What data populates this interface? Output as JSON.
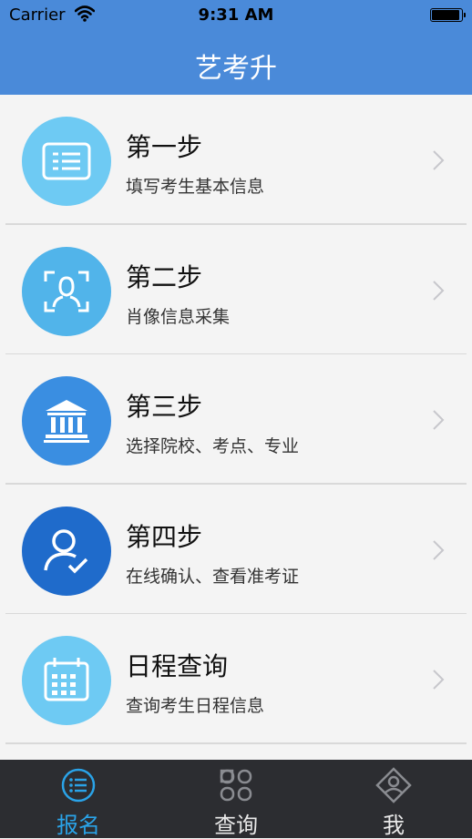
{
  "status_bar": {
    "carrier": "Carrier",
    "time": "9:31 AM"
  },
  "nav": {
    "title": "艺考升"
  },
  "steps": [
    {
      "title": "第一步",
      "subtitle": "填写考生基本信息",
      "icon": "id-card-icon",
      "color": "#6ecaf3"
    },
    {
      "title": "第二步",
      "subtitle": "肖像信息采集",
      "icon": "face-scan-icon",
      "color": "#51b4ea"
    },
    {
      "title": "第三步",
      "subtitle": "选择院校、考点、专业",
      "icon": "institution-icon",
      "color": "#3a8ee1"
    },
    {
      "title": "第四步",
      "subtitle": "在线确认、查看准考证",
      "icon": "user-check-icon",
      "color": "#1f6bcb"
    },
    {
      "title": "日程查询",
      "subtitle": "查询考生日程信息",
      "icon": "calendar-icon",
      "color": "#6ecaf3"
    }
  ],
  "tabs": [
    {
      "label": "报名",
      "icon": "list-circle-icon",
      "active": true
    },
    {
      "label": "查询",
      "icon": "grid-icon",
      "active": false
    },
    {
      "label": "我",
      "icon": "profile-diamond-icon",
      "active": false
    }
  ],
  "colors": {
    "header": "#4a8ad9",
    "tab_active": "#2aa3e8",
    "tab_bar": "#2c2d31"
  }
}
